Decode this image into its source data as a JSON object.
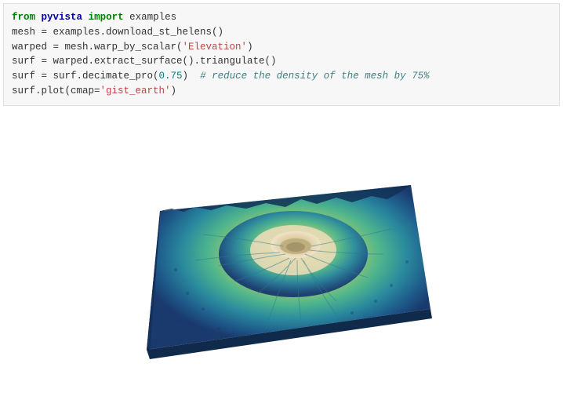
{
  "code": {
    "line1": {
      "kw_from": "from",
      "module": "pyvista",
      "kw_import": "import",
      "name": "examples"
    },
    "line2": "mesh = examples.download_st_helens()",
    "line3": {
      "pre": "warped = mesh.warp_by_scalar(",
      "str": "'Elevation'",
      "post": ")"
    },
    "line4": "surf = warped.extract_surface().triangulate()",
    "line5": {
      "pre": "surf = surf.decimate_pro(",
      "num": "0.75",
      "mid": ")  ",
      "comment": "# reduce the density of the mesh by 75%"
    },
    "line6": {
      "pre": "surf.plot(cmap=",
      "str": "'gist_earth'",
      "post": ")"
    }
  },
  "plot": {
    "cmap": "gist_earth",
    "source": "st_helens",
    "scalar": "Elevation",
    "decimate": 0.75
  }
}
